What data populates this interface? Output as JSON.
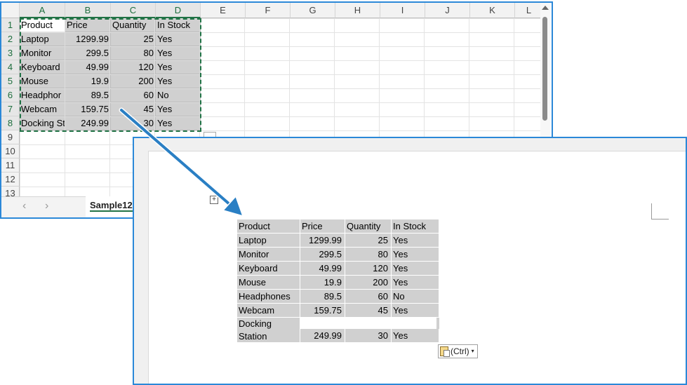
{
  "excel": {
    "columns": [
      "A",
      "B",
      "C",
      "D",
      "E",
      "F",
      "G",
      "H",
      "I",
      "J",
      "K",
      "L"
    ],
    "rows": [
      "1",
      "2",
      "3",
      "4",
      "5",
      "6",
      "7",
      "8",
      "9",
      "10",
      "11",
      "12",
      "13"
    ],
    "cells": [
      [
        "Product",
        "Price",
        "Quantity",
        "In Stock"
      ],
      [
        "Laptop",
        "1299.99",
        "25",
        "Yes"
      ],
      [
        "Monitor",
        "299.5",
        "80",
        "Yes"
      ],
      [
        "Keyboard",
        "49.99",
        "120",
        "Yes"
      ],
      [
        "Mouse",
        "19.9",
        "200",
        "Yes"
      ],
      [
        "Headphor",
        "89.5",
        "60",
        "No"
      ],
      [
        "Webcam",
        "159.75",
        "45",
        "Yes"
      ],
      [
        "Docking St",
        "249.99",
        "30",
        "Yes"
      ]
    ],
    "sheet_tab": "Sample12",
    "nav_prev": "‹",
    "nav_next": "›"
  },
  "word": {
    "headers": [
      "Product",
      "Price",
      "Quantity",
      "In Stock"
    ],
    "rows": [
      [
        "Laptop",
        "1299.99",
        "25",
        "Yes"
      ],
      [
        "Monitor",
        "299.5",
        "80",
        "Yes"
      ],
      [
        "Keyboard",
        "49.99",
        "120",
        "Yes"
      ],
      [
        "Mouse",
        "19.9",
        "200",
        "Yes"
      ],
      [
        "Headphones",
        "89.5",
        "60",
        "No"
      ],
      [
        "Webcam",
        "159.75",
        "45",
        "Yes"
      ],
      [
        "Docking Station",
        "249.99",
        "30",
        "Yes"
      ]
    ],
    "paste_options_label": "(Ctrl)",
    "table_handle": "+"
  },
  "colors": {
    "excel_green": "#217346",
    "border_blue": "#2b88d8",
    "arrow_blue": "#2a7fc4",
    "selection_gray": "#d0d0d0"
  }
}
